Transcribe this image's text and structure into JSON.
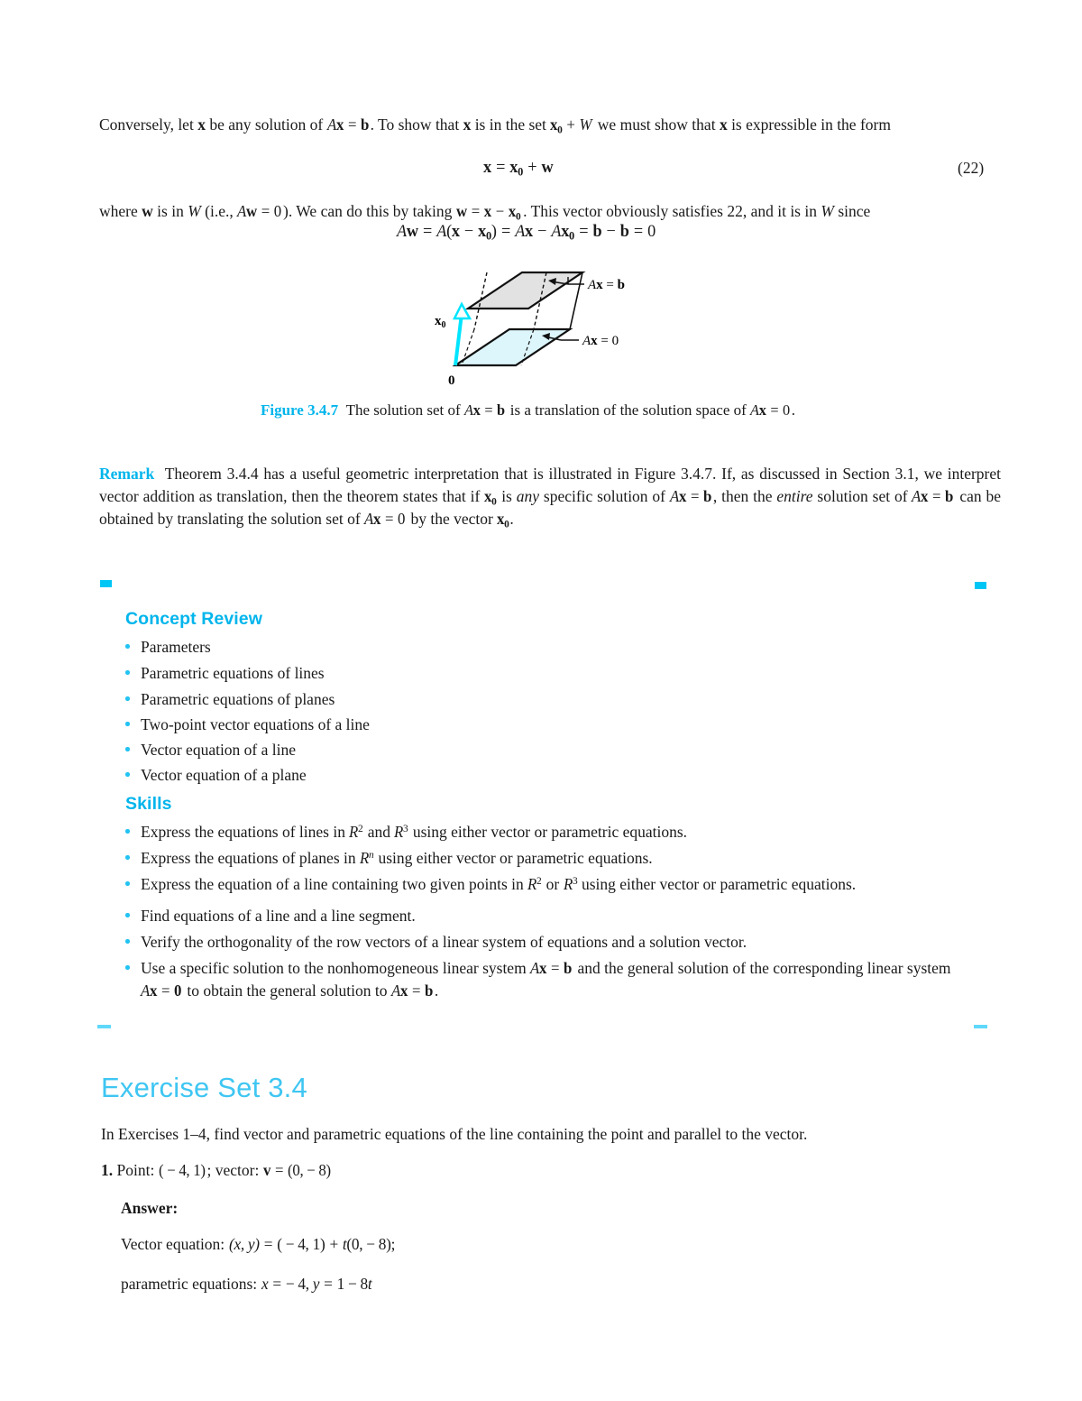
{
  "colors": {
    "accent_cyan": "#00b5ec",
    "marker_cyan": "#00c6f5",
    "rule_cyan": "#5fd8fa",
    "exercise_title_cyan": "#3fc6f2",
    "plane_top_fill": "#e2e2e2",
    "plane_bottom_fill": "#ddf6fb",
    "vector_arrow": "#00e5ff"
  },
  "body": {
    "paragraph_1": {
      "part_a": "Conversely, let ",
      "bold_x": "x",
      "part_b": " be any solution of ",
      "math_axb": "Ax = b",
      "part_c": ". To show that ",
      "bold_x2": "x",
      "part_d": " is in the set ",
      "math_x0w": "x0 + W",
      "part_e": " we must show that ",
      "bold_x3": "x",
      "part_f": " is expressible in the form"
    },
    "equation_22": {
      "math": "x = x0 + w",
      "number": "(22)"
    },
    "paragraph_2": {
      "part_a": "where ",
      "bold_w": "w",
      "part_b": " is in ",
      "italic_W": "W",
      "part_c": " (i.e., ",
      "math_aw0": "Aw = 0",
      "part_d": "). We can do this by taking ",
      "math_wxx0": "w = x − x0",
      "part_e": ". This vector obviously satisfies 22, and it is in ",
      "italic_W2": "W",
      "part_f": " since"
    },
    "equation_unnumbered": "Aw = A(x − x0) = Ax − Ax0 = b − b = 0"
  },
  "figure": {
    "label": "Figure 3.4.7",
    "caption_a": "The solution set of ",
    "caption_math_1": "Ax = b",
    "caption_b": " is a translation of the solution space of ",
    "caption_math_2": "Ax = 0",
    "caption_c": ".",
    "plane_top_label": "Ax = b",
    "plane_bottom_label": "Ax = 0",
    "vector_label": "x0",
    "origin_label": "0"
  },
  "remark": {
    "label": "Remark",
    "text_a": "Theorem 3.4.4 has a useful geometric interpretation that is illustrated in Figure 3.4.7. If, as discussed in Section 3.1, we interpret vector addition as translation, then the theorem states that if ",
    "math_x0": "x0",
    "text_b": " is ",
    "italic_any": "any",
    "text_c": " specific solution of ",
    "math_axb": "Ax = b",
    "text_d": ", then the ",
    "italic_entire": "entire",
    "text_e": " solution set of ",
    "math_axb2": "Ax = b",
    "text_f": " can be obtained by translating the solution set of ",
    "math_ax0": "Ax = 0",
    "text_g": " by the vector ",
    "math_x0_2": "x0",
    "text_h": "."
  },
  "concept_review": {
    "heading": "Concept Review",
    "items": [
      "Parameters",
      "Parametric equations of lines",
      "Parametric equations of planes",
      "Two-point vector equations of a line",
      "Vector equation of a line",
      "Vector equation of a plane"
    ]
  },
  "skills": {
    "heading": "Skills",
    "items": [
      {
        "a": "Express the equations of lines in ",
        "m1": "R2",
        "b": " and ",
        "m2": "R3",
        "c": " using either vector or parametric equations."
      },
      {
        "a": "Express the equations of planes in ",
        "m1": "Rn",
        "b": " using either vector or parametric equations.",
        "m2": "",
        "c": ""
      },
      {
        "a": "Express the equation of a line containing two given points in ",
        "m1": "R2",
        "b": " or ",
        "m2": "R3",
        "c": " using either vector or parametric equations."
      },
      {
        "a": "Find equations of a line and a line segment.",
        "m1": "",
        "b": "",
        "m2": "",
        "c": ""
      },
      {
        "a": "Verify the orthogonality of the row vectors of a linear system of equations and a solution vector.",
        "m1": "",
        "b": "",
        "m2": "",
        "c": ""
      },
      {
        "a": "Use a specific solution to the nonhomogeneous linear system ",
        "m1": "Ax = b",
        "b": " and the general solution of the corresponding linear system ",
        "m2": "Ax = 0",
        "c": " to obtain the general solution to ",
        "m3": "Ax = b",
        "d": "."
      }
    ]
  },
  "exercise_set": {
    "title": "Exercise Set 3.4",
    "intro": "In Exercises 1–4, find vector and parametric equations of the line containing the point and parallel to the vector.",
    "problem_number": "1.",
    "problem_text_a": "Point: ",
    "problem_math_point": "( − 4, 1)",
    "problem_text_b": "; vector: ",
    "problem_math_vector": "v = (0, − 8)",
    "answer_label": "Answer:",
    "vector_equation_label": "Vector equation: ",
    "vector_equation_math": "(x, y) = ( − 4, 1) + t(0, − 8);",
    "parametric_label": "parametric equations: ",
    "parametric_math": "x = − 4, y = 1 − 8t"
  }
}
